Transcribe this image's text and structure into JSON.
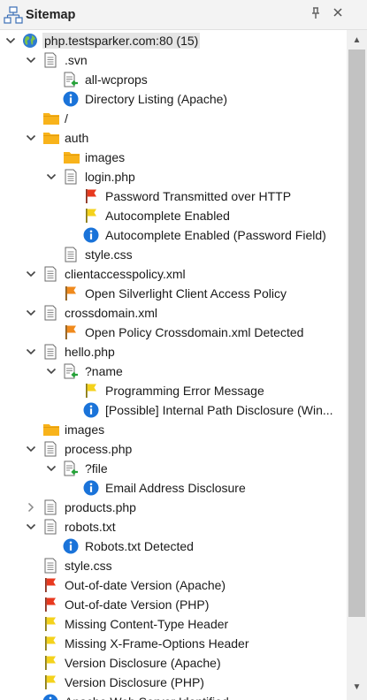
{
  "panel": {
    "title": "Sitemap",
    "pin_icon": "pin-icon",
    "close_icon": "close-icon"
  },
  "colors": {
    "folder": "#f8b31b",
    "flag_red": "#e8391f",
    "flag_orange": "#f08a1d",
    "flag_yellow": "#f4d21c",
    "info": "#1a73d9",
    "selection": "#e5e5e5"
  },
  "tree": [
    {
      "label": "php.testsparker.com:80 (15)",
      "icon": "globe-icon",
      "expander": "expanded",
      "depth": 0,
      "selected": true
    },
    {
      "label": ".svn",
      "icon": "page-icon",
      "expander": "expanded",
      "depth": 1
    },
    {
      "label": "all-wcprops",
      "icon": "page-arrow-icon",
      "expander": "none",
      "depth": 2
    },
    {
      "label": "Directory Listing (Apache)",
      "icon": "info-icon",
      "expander": "none",
      "depth": 2
    },
    {
      "label": "/",
      "icon": "folder-icon",
      "expander": "none",
      "depth": 1
    },
    {
      "label": "auth",
      "icon": "folder-icon",
      "expander": "expanded",
      "depth": 1
    },
    {
      "label": "images",
      "icon": "folder-icon",
      "expander": "none",
      "depth": 2
    },
    {
      "label": "login.php",
      "icon": "page-icon",
      "expander": "expanded",
      "depth": 2
    },
    {
      "label": "Password Transmitted over HTTP",
      "icon": "flag-red-icon",
      "expander": "none",
      "depth": 3
    },
    {
      "label": "Autocomplete Enabled",
      "icon": "flag-yellow-icon",
      "expander": "none",
      "depth": 3
    },
    {
      "label": "Autocomplete Enabled (Password Field)",
      "icon": "info-icon",
      "expander": "none",
      "depth": 3
    },
    {
      "label": "style.css",
      "icon": "page-icon",
      "expander": "none",
      "depth": 2
    },
    {
      "label": "clientaccesspolicy.xml",
      "icon": "page-icon",
      "expander": "expanded",
      "depth": 1
    },
    {
      "label": "Open Silverlight Client Access Policy",
      "icon": "flag-orange-icon",
      "expander": "none",
      "depth": 2
    },
    {
      "label": "crossdomain.xml",
      "icon": "page-icon",
      "expander": "expanded",
      "depth": 1
    },
    {
      "label": "Open Policy Crossdomain.xml Detected",
      "icon": "flag-orange-icon",
      "expander": "none",
      "depth": 2
    },
    {
      "label": "hello.php",
      "icon": "page-icon",
      "expander": "expanded",
      "depth": 1
    },
    {
      "label": "?name",
      "icon": "page-arrow-icon",
      "expander": "expanded",
      "depth": 2
    },
    {
      "label": "Programming Error Message",
      "icon": "flag-yellow-icon",
      "expander": "none",
      "depth": 3
    },
    {
      "label": "[Possible] Internal Path Disclosure (Win...",
      "icon": "info-icon",
      "expander": "none",
      "depth": 3
    },
    {
      "label": "images",
      "icon": "folder-icon",
      "expander": "none",
      "depth": 1
    },
    {
      "label": "process.php",
      "icon": "page-icon",
      "expander": "expanded",
      "depth": 1
    },
    {
      "label": "?file",
      "icon": "page-arrow-icon",
      "expander": "expanded",
      "depth": 2
    },
    {
      "label": "Email Address Disclosure",
      "icon": "info-icon",
      "expander": "none",
      "depth": 3
    },
    {
      "label": "products.php",
      "icon": "page-icon",
      "expander": "collapsed",
      "depth": 1
    },
    {
      "label": "robots.txt",
      "icon": "page-icon",
      "expander": "expanded",
      "depth": 1
    },
    {
      "label": "Robots.txt Detected",
      "icon": "info-icon",
      "expander": "none",
      "depth": 2
    },
    {
      "label": "style.css",
      "icon": "page-icon",
      "expander": "none",
      "depth": 1
    },
    {
      "label": "Out-of-date Version (Apache)",
      "icon": "flag-red-icon",
      "expander": "none",
      "depth": 1
    },
    {
      "label": "Out-of-date Version (PHP)",
      "icon": "flag-red-icon",
      "expander": "none",
      "depth": 1
    },
    {
      "label": "Missing Content-Type Header",
      "icon": "flag-yellow-icon",
      "expander": "none",
      "depth": 1
    },
    {
      "label": "Missing X-Frame-Options Header",
      "icon": "flag-yellow-icon",
      "expander": "none",
      "depth": 1
    },
    {
      "label": "Version Disclosure (Apache)",
      "icon": "flag-yellow-icon",
      "expander": "none",
      "depth": 1
    },
    {
      "label": "Version Disclosure (PHP)",
      "icon": "flag-yellow-icon",
      "expander": "none",
      "depth": 1
    },
    {
      "label": "Apache Web Server Identified",
      "icon": "info-icon",
      "expander": "none",
      "depth": 1
    }
  ]
}
